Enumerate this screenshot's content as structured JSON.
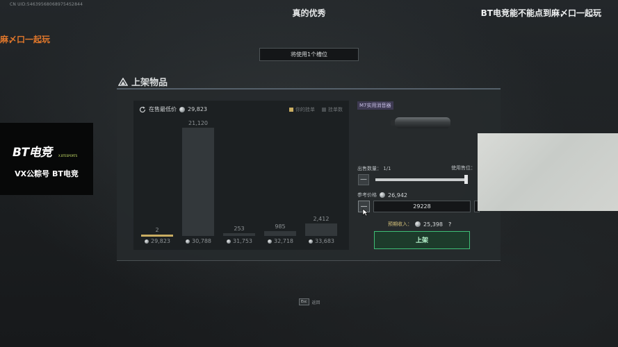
{
  "overlay": {
    "uid": "CN UID:546395680689754S2844",
    "stream_title": "真的优秀",
    "top_right_text": "BT电竞能不能点到麻〆口一起玩",
    "left_orange_text": "麻〆口一起玩",
    "logo_text": "BT电竞",
    "logo_sub": "X.BTESPORTS",
    "vx_text": "VX公粽号 BT电竞"
  },
  "slot_banner": "将使用1个槽位",
  "section_title": "上架物品",
  "chart": {
    "lowest_label": "在售最低价",
    "lowest_price": "29,823",
    "legend_yours": "你的挂单",
    "legend_listed": "挂单数",
    "colors": {
      "yours": "#c9ad62",
      "listed": "#3a3f42"
    }
  },
  "chart_data": {
    "type": "bar",
    "categories": [
      "29,823",
      "30,788",
      "31,753",
      "32,718",
      "33,683"
    ],
    "values": [
      2,
      21120,
      253,
      985,
      2412
    ],
    "value_labels": [
      "2",
      "21,120",
      "253",
      "985",
      "2,412"
    ],
    "highlighted_index": 0
  },
  "item": {
    "name": "M7实用消音器",
    "sell_qty_label": "出售数量：",
    "sell_qty_value": "1/1",
    "use_slot_label": "使用售位：",
    "slider_fraction": 1.0,
    "ref_price_label": "参考价格",
    "ref_price": "26,942",
    "price_value": "29228",
    "income_label": "预期收入：",
    "income_value": "25,398",
    "help": "?",
    "list_button": "上架"
  },
  "footer": {
    "esc_key": "Esc",
    "back_label": "返回"
  }
}
